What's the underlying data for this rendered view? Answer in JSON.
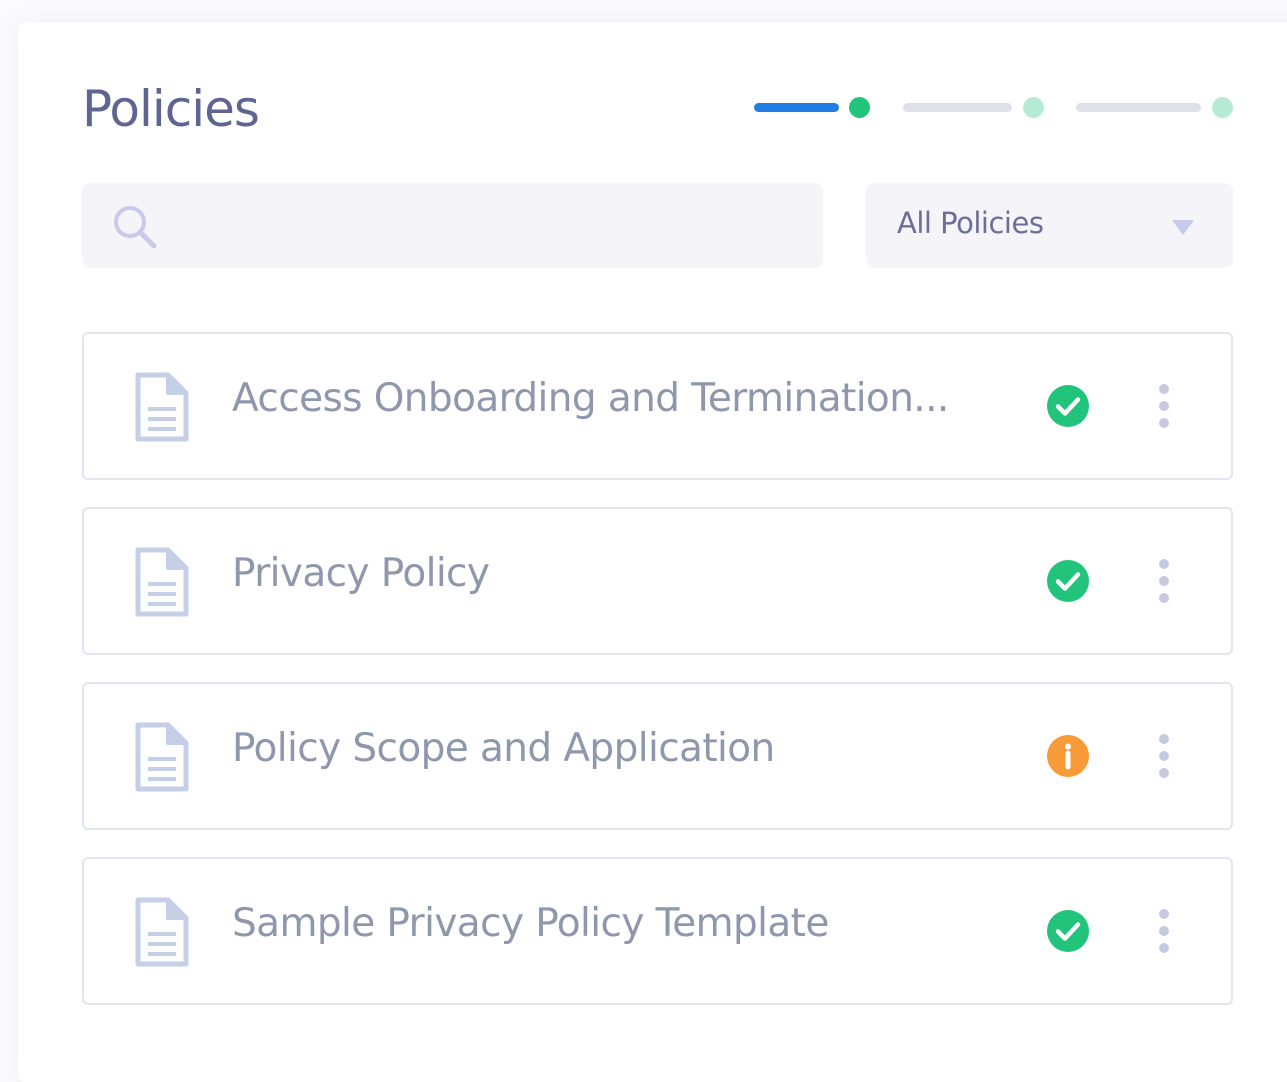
{
  "header": {
    "title": "Policies"
  },
  "stepper": {
    "steps": [
      {
        "state": "active",
        "bar_color": "#1f7de6",
        "dot_color": "#21c47a"
      },
      {
        "state": "pending",
        "bar_color": "#dfe1ea",
        "dot_color": "#b6ecd3"
      },
      {
        "state": "pending",
        "bar_color": "#dfe1ea",
        "dot_color": "#b6ecd3"
      }
    ]
  },
  "search": {
    "value": "",
    "placeholder": "",
    "icon": "search-icon"
  },
  "filter": {
    "selected": "All Policies",
    "icon": "chevron-down-icon"
  },
  "policies": [
    {
      "name": "Access Onboarding and Termination...",
      "status": "approved",
      "status_icon": "check-circle-icon"
    },
    {
      "name": "Privacy Policy",
      "status": "approved",
      "status_icon": "check-circle-icon"
    },
    {
      "name": "Policy Scope and Application",
      "status": "attention",
      "status_icon": "info-circle-icon"
    },
    {
      "name": "Sample Privacy Policy Template",
      "status": "approved",
      "status_icon": "check-circle-icon"
    }
  ],
  "colors": {
    "title": "#5e6591",
    "approved": "#21c47a",
    "attention": "#f69b37",
    "doc_icon": "#c5cfe6",
    "row_border": "#e3e4f2",
    "field_bg": "#f4f4f9"
  }
}
